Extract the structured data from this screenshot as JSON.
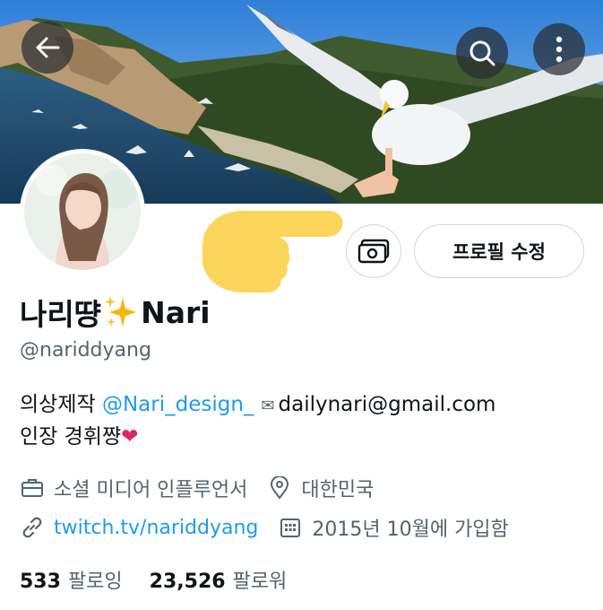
{
  "header": {
    "back_icon": "arrow-left-icon",
    "search_icon": "search-icon",
    "more_icon": "more-vertical-icon"
  },
  "profile": {
    "name_prefix": "나리땽",
    "name_suffix": "Nari",
    "handle": "@nariddyang",
    "edit_button_label": "프로필 수정",
    "money_icon": "money-icon"
  },
  "bio": {
    "line1_prefix": "의상제작 ",
    "mention": "@Nari_design_",
    "email": "dailynari@gmail.com",
    "line2": "인장 경휘쨩"
  },
  "meta": {
    "category": "소셜 미디어 인플루언서",
    "location": "대한민국",
    "link": "twitch.tv/nariddyang",
    "joined": "2015년 10월에 가입함"
  },
  "stats": {
    "following_count": "533",
    "following_label": "팔로잉",
    "followers_count": "23,526",
    "followers_label": "팔로워"
  },
  "colors": {
    "accent": "#1d9bf0",
    "secondary_text": "#536471",
    "border": "#cfd9de",
    "pointer": "#fcd34d"
  }
}
